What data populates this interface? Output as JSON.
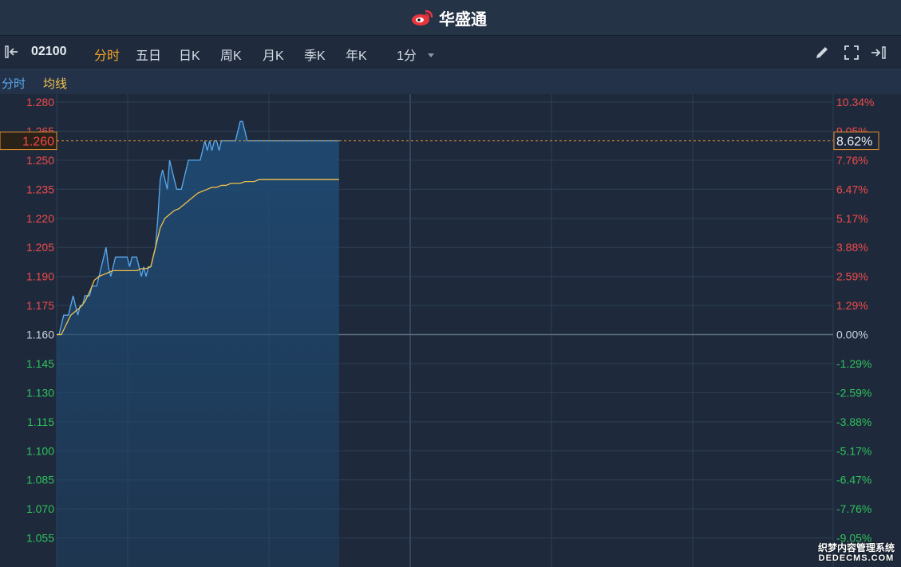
{
  "app": {
    "brand": "华盛通",
    "watermark": "织梦内容管理系统\nDEDECMS.COM"
  },
  "toolbar": {
    "symbol": "02100",
    "tabs": [
      "分时",
      "五日",
      "日K",
      "周K",
      "月K",
      "季K",
      "年K"
    ],
    "active_tab": "分时",
    "interval": "1分"
  },
  "legend": {
    "items": [
      "分时",
      "均线"
    ]
  },
  "colors": {
    "up": "#f04a4a",
    "down": "#2fc25b",
    "price_line": "#5aa9ee",
    "avg_line": "#f2c14e",
    "area_fill": "#1f4a73",
    "grid": "#2f3f55",
    "crosshair": "#e8922e",
    "accent": "#f5a623"
  },
  "crosshair": {
    "price": "1.260",
    "pct": "8.62%"
  },
  "chart_data": {
    "type": "line",
    "prev_close": 1.16,
    "ylim": [
      1.04,
      1.28
    ],
    "y_ticks_left": [
      "1.280",
      "1.265",
      "1.250",
      "1.235",
      "1.220",
      "1.205",
      "1.190",
      "1.175",
      "1.160",
      "1.145",
      "1.130",
      "1.115",
      "1.100",
      "1.085",
      "1.070",
      "1.055"
    ],
    "y_ticks_right": [
      "10.34%",
      "9.05%",
      "7.76%",
      "6.47%",
      "5.17%",
      "3.88%",
      "2.59%",
      "1.29%",
      "0.00%",
      "-1.29%",
      "-2.59%",
      "-3.88%",
      "-5.17%",
      "-6.47%",
      "-7.76%",
      "-9.05%"
    ],
    "series": [
      {
        "x": [
          0,
          1,
          2,
          3,
          4,
          5,
          6,
          7,
          8,
          9,
          10,
          11,
          12,
          13,
          14,
          15,
          16,
          17,
          18,
          19,
          20,
          21,
          22,
          23,
          24,
          25,
          26,
          27,
          28,
          29,
          30,
          31,
          32,
          33,
          34,
          35,
          36,
          37,
          38,
          39,
          40,
          41,
          42,
          43,
          44,
          45,
          46,
          47,
          48,
          49,
          50,
          51,
          52,
          53,
          54,
          55,
          56,
          57,
          58,
          59,
          60,
          61,
          62,
          63,
          64,
          65,
          66,
          67,
          68,
          69,
          70,
          71,
          72,
          73,
          74,
          75,
          76,
          77,
          78,
          79,
          80,
          81,
          82,
          83,
          84,
          85,
          86,
          87,
          88,
          89,
          90,
          91,
          92,
          93,
          94,
          95,
          96,
          97,
          98,
          99,
          100,
          101,
          102,
          103,
          104,
          105,
          106,
          107,
          108,
          109,
          110,
          111,
          112,
          113,
          114,
          115,
          116,
          117,
          118,
          119,
          120
        ],
        "values": [
          1.16,
          1.16,
          1.165,
          1.17,
          1.17,
          1.17,
          1.175,
          1.18,
          1.175,
          1.17,
          1.175,
          1.175,
          1.18,
          1.18,
          1.18,
          1.185,
          1.185,
          1.185,
          1.19,
          1.195,
          1.2,
          1.205,
          1.195,
          1.19,
          1.195,
          1.2,
          1.2,
          1.2,
          1.2,
          1.2,
          1.2,
          1.195,
          1.2,
          1.2,
          1.2,
          1.195,
          1.19,
          1.195,
          1.19,
          1.195,
          1.195,
          1.2,
          1.205,
          1.22,
          1.24,
          1.245,
          1.24,
          1.235,
          1.25,
          1.245,
          1.24,
          1.235,
          1.235,
          1.235,
          1.24,
          1.245,
          1.25,
          1.25,
          1.25,
          1.25,
          1.25,
          1.25,
          1.255,
          1.26,
          1.255,
          1.26,
          1.255,
          1.26,
          1.26,
          1.255,
          1.26,
          1.26,
          1.26,
          1.26,
          1.26,
          1.26,
          1.26,
          1.265,
          1.27,
          1.27,
          1.265,
          1.26,
          1.26,
          1.26,
          1.26,
          1.26,
          1.26,
          1.26,
          1.26,
          1.26,
          1.26,
          1.26,
          1.26,
          1.26,
          1.26,
          1.26,
          1.26,
          1.26,
          1.26,
          1.26,
          1.26,
          1.26,
          1.26,
          1.26,
          1.26,
          1.26,
          1.26,
          1.26,
          1.26,
          1.26,
          1.26,
          1.26,
          1.26,
          1.26,
          1.26,
          1.26,
          1.26,
          1.26,
          1.26,
          1.26,
          1.26
        ]
      },
      {
        "x": [
          0,
          2,
          4,
          6,
          8,
          10,
          12,
          14,
          16,
          18,
          20,
          22,
          24,
          26,
          28,
          30,
          32,
          34,
          36,
          38,
          40,
          42,
          44,
          46,
          48,
          50,
          52,
          54,
          56,
          58,
          60,
          62,
          64,
          66,
          68,
          70,
          72,
          74,
          76,
          78,
          80,
          82,
          84,
          86,
          88,
          90,
          92,
          94,
          96,
          98,
          100,
          102,
          104,
          106,
          108,
          110,
          112,
          114,
          116,
          118,
          120
        ],
        "values": [
          1.16,
          1.16,
          1.165,
          1.17,
          1.172,
          1.174,
          1.177,
          1.182,
          1.188,
          1.19,
          1.191,
          1.192,
          1.193,
          1.193,
          1.193,
          1.193,
          1.193,
          1.193,
          1.194,
          1.194,
          1.195,
          1.205,
          1.215,
          1.22,
          1.222,
          1.224,
          1.225,
          1.227,
          1.229,
          1.231,
          1.233,
          1.234,
          1.235,
          1.236,
          1.236,
          1.237,
          1.237,
          1.238,
          1.238,
          1.238,
          1.239,
          1.239,
          1.239,
          1.24,
          1.24,
          1.24,
          1.24,
          1.24,
          1.24,
          1.24,
          1.24,
          1.24,
          1.24,
          1.24,
          1.24,
          1.24,
          1.24,
          1.24,
          1.24,
          1.24,
          1.24
        ]
      }
    ]
  }
}
